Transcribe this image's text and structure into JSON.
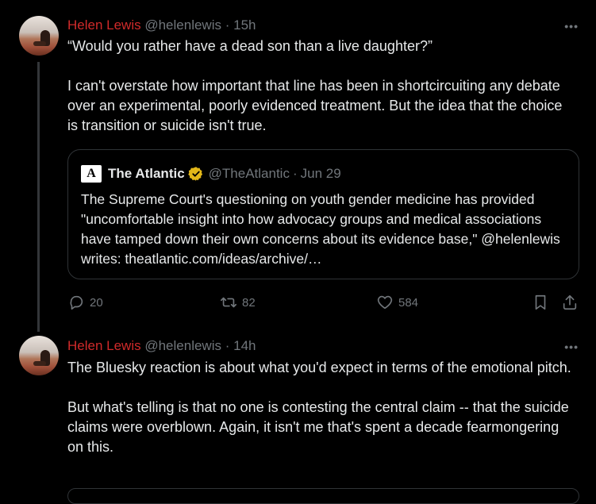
{
  "tweet1": {
    "author_name": "Helen Lewis",
    "handle": "@helenlewis",
    "separator": "·",
    "time": "15h",
    "more_label": "•••",
    "paragraphs": [
      "“Would you rather have a dead son than a live daughter?”",
      "I can't overstate how important that line has been in shortcircuiting any debate over an experimental, poorly evidenced treatment. But the idea that the choice is transition or suicide isn't true."
    ],
    "quote": {
      "logo_letter": "A",
      "name": "The Atlantic",
      "handle": "@TheAtlantic",
      "separator": "·",
      "date": "Jun 29",
      "text": "The Supreme Court's questioning on youth gender medicine has provided \"uncomfortable insight into how advocacy groups and medical associations have tamped down their own concerns about its evidence base,\" @helenlewis writes: theatlantic.com/ideas/archive/…",
      "verified_color": "#e2b719"
    },
    "actions": {
      "replies": "20",
      "reposts": "82",
      "likes": "584"
    }
  },
  "tweet2": {
    "author_name": "Helen Lewis",
    "handle": "@helenlewis",
    "separator": "·",
    "time": "14h",
    "more_label": "•••",
    "paragraphs": [
      "The Bluesky reaction is about what you'd expect in terms of the emotional pitch.",
      "But what's telling is that no one is contesting the central claim -- that the suicide claims were overblown. Again, it isn't me that's spent a decade fearmongering on this."
    ]
  },
  "colors": {
    "name": "#d02a2a",
    "muted": "#71767b",
    "background": "#000000"
  }
}
